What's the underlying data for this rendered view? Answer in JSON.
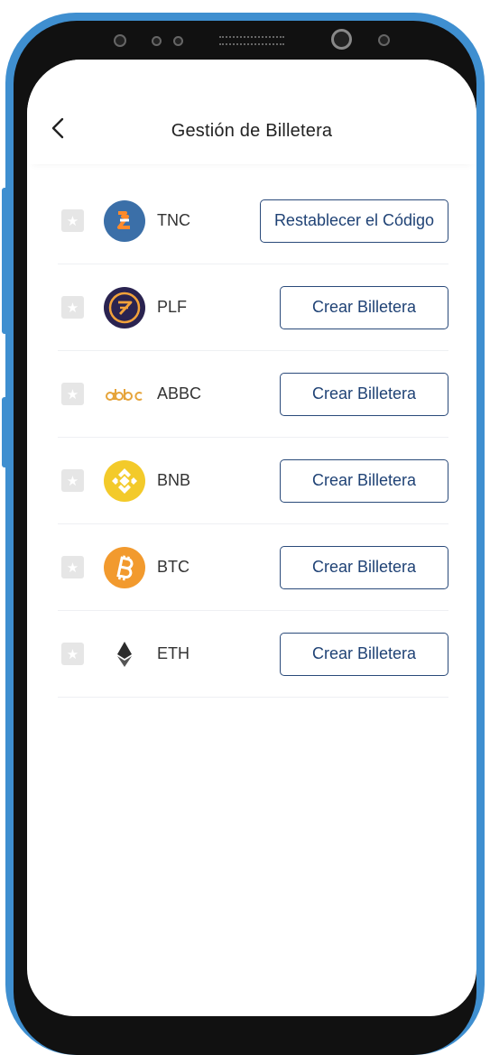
{
  "header": {
    "title": "Gestión de Billetera"
  },
  "colors": {
    "button_border": "#2a4a7a",
    "button_text": "#1f4275",
    "phone_frame": "#3f8fd0"
  },
  "wallets": [
    {
      "symbol": "TNC",
      "icon": "tnc-icon",
      "action": "Restablecer el Código"
    },
    {
      "symbol": "PLF",
      "icon": "plf-icon",
      "action": "Crear Billetera"
    },
    {
      "symbol": "ABBC",
      "icon": "abbc-icon",
      "action": "Crear Billetera"
    },
    {
      "symbol": "BNB",
      "icon": "bnb-icon",
      "action": "Crear Billetera"
    },
    {
      "symbol": "BTC",
      "icon": "btc-icon",
      "action": "Crear Billetera"
    },
    {
      "symbol": "ETH",
      "icon": "eth-icon",
      "action": "Crear Billetera"
    }
  ]
}
